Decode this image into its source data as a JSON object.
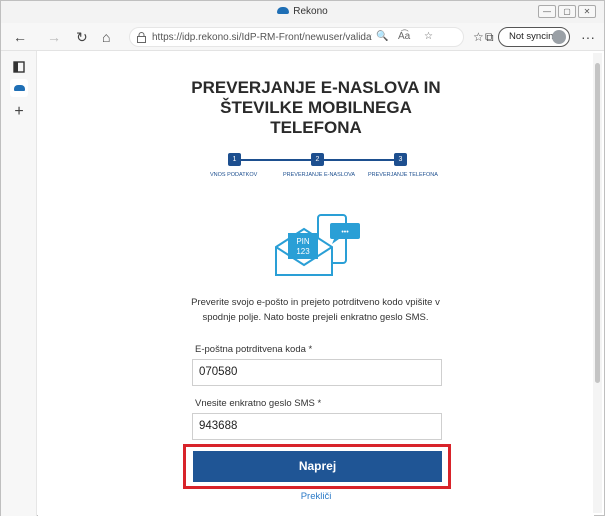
{
  "window": {
    "title": "Rekono",
    "buttons": [
      "—",
      "▢",
      "✕"
    ]
  },
  "toolbar": {
    "url": "https://idp.rekono.si/IdP-RM-Front/newuser/validateE...",
    "address_icons": [
      "🔍",
      "A͡a",
      "☆"
    ],
    "sync_label": "Not syncing",
    "more": "···"
  },
  "sidebar": {
    "items": [
      "tabs-icon",
      "rekono-icon",
      "add-icon"
    ],
    "add_glyph": "+"
  },
  "page": {
    "heading_line1": "PREVERJANJE E-NASLOVA IN",
    "heading_line2": "ŠTEVILKE MOBILNEGA",
    "heading_line3": "TELEFONA",
    "steps": [
      {
        "number": "1",
        "label": "VNOS PODATKOV"
      },
      {
        "number": "2",
        "label": "PREVERJANJE E-NASLOVA"
      },
      {
        "number": "3",
        "label": "PREVERJANJE TELEFONA"
      }
    ],
    "pin_label": "PIN",
    "pin_code": "123",
    "bubble_dots": "•••",
    "description_line1": "Preverite svojo e-pošto in prejeto potrditveno kodo vpišite v",
    "description_line2": "spodnje polje. Nato boste prejeli enkratno geslo SMS.",
    "email_code_label": "E-poštna potrditvena koda *",
    "email_code_value": "070580",
    "sms_label": "Vnesite enkratno geslo SMS *",
    "sms_value": "943688",
    "next_button": "Naprej",
    "cancel_link": "Prekliči"
  },
  "colors": {
    "primary": "#1f5595",
    "highlight": "#d8232a",
    "link": "#2a7ac7",
    "illustration": "#2a9fd6"
  }
}
